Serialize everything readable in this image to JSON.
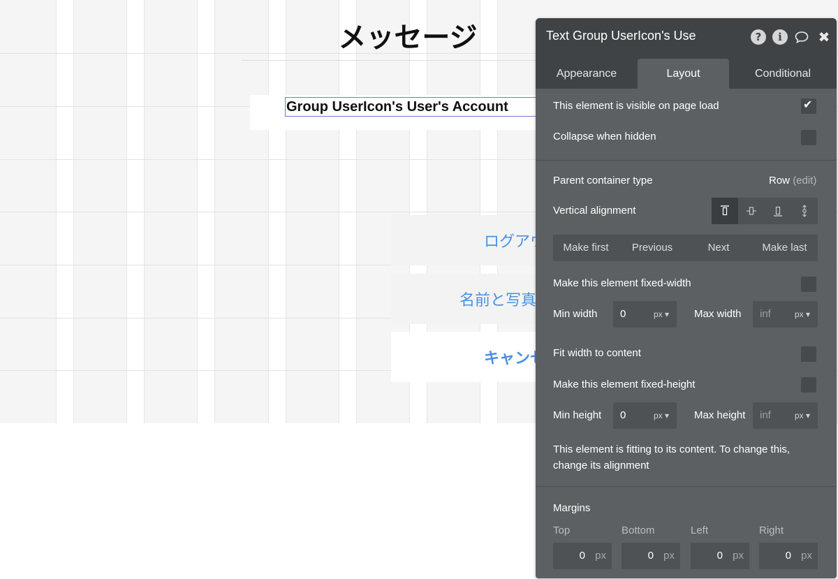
{
  "canvas": {
    "page_title": "メッセージ",
    "account_text": "Group UserIcon's User's Account",
    "menu": {
      "logout": "ログアウ",
      "name_photo": "名前と写真",
      "cancel": "キャンセ"
    }
  },
  "panel": {
    "title": "Text Group UserIcon's Use",
    "header_icons": {
      "help": "?",
      "info": "i",
      "comment": "◯",
      "close": "✖"
    },
    "tabs": [
      "Appearance",
      "Layout",
      "Conditional"
    ],
    "active_tab": "Layout",
    "visible_on_load": {
      "label": "This element is visible on page load",
      "checked": true
    },
    "collapse_hidden": {
      "label": "Collapse when hidden",
      "checked": false
    },
    "parent_container": {
      "label": "Parent container type",
      "value": "Row",
      "edit": "(edit)"
    },
    "vertical_alignment": {
      "label": "Vertical alignment",
      "selected_index": 0
    },
    "order_buttons": [
      "Make first",
      "Previous",
      "Next",
      "Make last"
    ],
    "fixed_width": {
      "label": "Make this element fixed-width",
      "checked": false
    },
    "min_width": {
      "label": "Min width",
      "value": "0",
      "unit": "px"
    },
    "max_width": {
      "label": "Max width",
      "placeholder": "inf",
      "unit": "px"
    },
    "fit_width": {
      "label": "Fit width to content",
      "checked": false
    },
    "fixed_height": {
      "label": "Make this element fixed-height",
      "checked": false
    },
    "min_height": {
      "label": "Min height",
      "value": "0",
      "unit": "px"
    },
    "max_height": {
      "label": "Max height",
      "placeholder": "inf",
      "unit": "px"
    },
    "fit_info": "This element is fitting to its content. To change this, change its alignment",
    "margins": {
      "label": "Margins",
      "fields": [
        {
          "label": "Top",
          "value": "0",
          "unit": "px"
        },
        {
          "label": "Bottom",
          "value": "0",
          "unit": "px"
        },
        {
          "label": "Left",
          "value": "0",
          "unit": "px"
        },
        {
          "label": "Right",
          "value": "0",
          "unit": "px"
        }
      ]
    }
  },
  "colors": {
    "panel_bg": "#5c6063",
    "panel_header": "#3f4346",
    "link_blue": "#4a90e2"
  }
}
